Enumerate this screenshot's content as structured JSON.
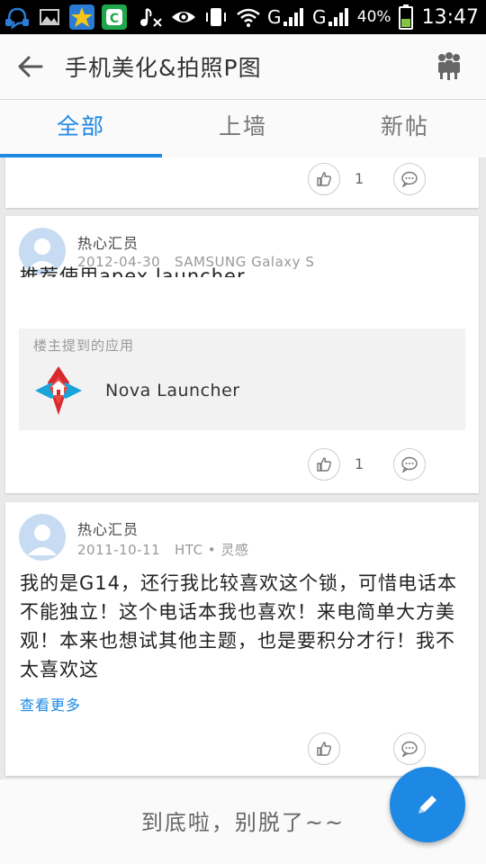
{
  "status_bar": {
    "battery_percent": "40%",
    "time": "13:47"
  },
  "header": {
    "title": "手机美化&拍照P图"
  },
  "tabs": [
    {
      "label": "全部",
      "active": true
    },
    {
      "label": "上墙",
      "active": false
    },
    {
      "label": "新帖",
      "active": false
    }
  ],
  "posts": [
    {
      "like_count": "1"
    },
    {
      "username": "热心汇员",
      "date": "2012-04-30",
      "device": "SAMSUNG Galaxy S",
      "text": "推荐使用apex launcher",
      "app_box": {
        "label": "楼主提到的应用",
        "app_name": "Nova Launcher"
      },
      "like_count": "1"
    },
    {
      "username": "热心汇员",
      "date": "2011-10-11",
      "device": "HTC • 灵感",
      "text": "我的是G14，还行我比较喜欢这个锁，可惜电话本不能独立！这个电话本我也喜欢！来电简单大方美观！本来也想试其他主题，也是要积分才行！我不太喜欢这",
      "see_more": "查看更多"
    }
  ],
  "footer": {
    "end_text": "到底啦，别脱了~~"
  },
  "colors": {
    "accent": "#1e88e5",
    "avatar_bg": "#c7dcf3"
  }
}
